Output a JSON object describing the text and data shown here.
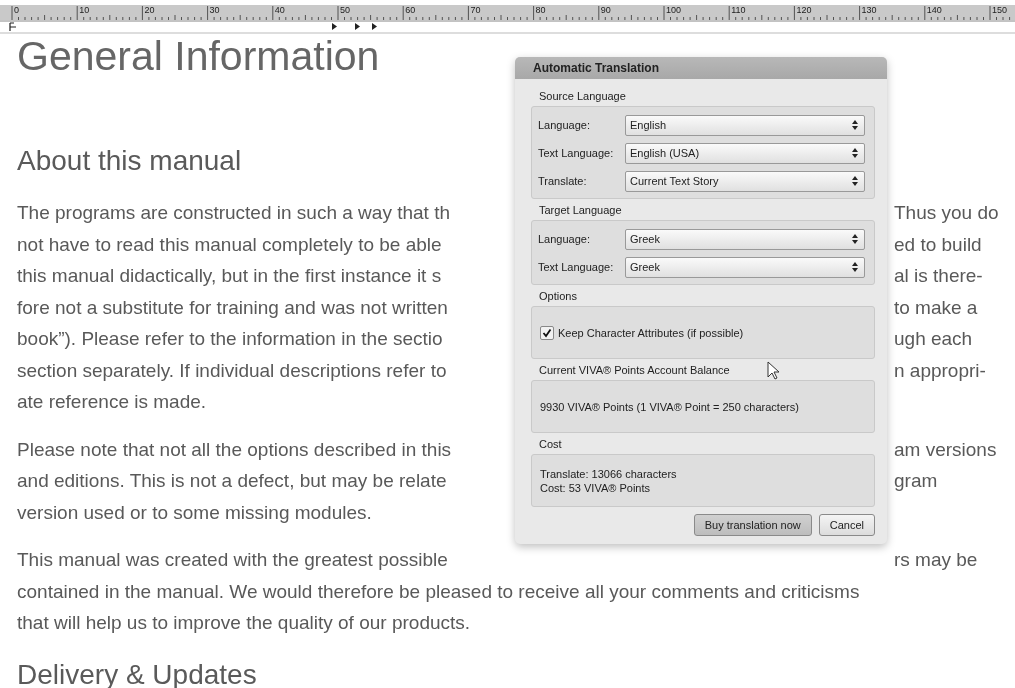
{
  "ruler": {
    "labels": [
      "0",
      "10",
      "20",
      "30",
      "40",
      "50",
      "60",
      "70",
      "80",
      "90",
      "100",
      "110",
      "120",
      "130",
      "140",
      "150"
    ]
  },
  "document": {
    "title": "General Information",
    "sections": [
      {
        "heading": "About this manual",
        "paragraphs": [
          {
            "lines": [
              {
                "left": "The programs are constructed in such a way that th",
                "right": "Thus you do"
              },
              {
                "left": "not have to read this manual completely to be able",
                "right": "ed to build"
              },
              {
                "left": "this manual didactically, but in the first instance it s",
                "right": "al is there-"
              },
              {
                "left": "fore not a substitute for training and was not written",
                "right": "to make a"
              },
              {
                "left": "book”). Please refer to the information in the sectio",
                "right": "ugh each"
              },
              {
                "left": "section separately. If individual descriptions refer to",
                "right": "n appropri-"
              },
              {
                "left": "ate reference is made."
              }
            ]
          },
          {
            "lines": [
              {
                "left": "Please note that not all the options described in this",
                "right": "am versions"
              },
              {
                "left": "and editions. This is not a defect, but may be relate",
                "right": "gram"
              },
              {
                "left": "version used or to some missing modules."
              }
            ]
          },
          {
            "lines": [
              {
                "left": "This manual was created with the greatest possible",
                "right": "rs may be"
              },
              {
                "left": "contained in the manual. We would therefore be pleased to receive all your comments and criticisms"
              },
              {
                "left": "that will help us to improve the quality of our products."
              }
            ]
          }
        ]
      },
      {
        "heading": "Delivery & Updates"
      }
    ]
  },
  "dialog": {
    "title": "Automatic Translation",
    "groups": [
      {
        "title": "Source Language",
        "kind": "selects",
        "rows": [
          {
            "label": "Language:",
            "value": "English"
          },
          {
            "label": "Text Language:",
            "value": "English (USA)"
          },
          {
            "label": "Translate:",
            "value": "Current Text Story"
          }
        ]
      },
      {
        "title": "Target Language",
        "kind": "selects",
        "rows": [
          {
            "label": "Language:",
            "value": "Greek"
          },
          {
            "label": "Text Language:",
            "value": "Greek"
          }
        ]
      },
      {
        "title": "Options",
        "kind": "checkbox",
        "items": [
          {
            "label": "Keep Character Attributes (if possible)",
            "checked": true
          }
        ]
      },
      {
        "title": "Current VIVA® Points Account Balance",
        "kind": "text",
        "lines": [
          "9930 VIVA® Points (1 VIVA® Point = 250 characters)"
        ]
      },
      {
        "title": "Cost",
        "kind": "text",
        "lines": [
          "Translate: 13066 characters",
          "Cost: 53 VIVA® Points"
        ]
      }
    ],
    "buttons": [
      {
        "label": "Buy translation now",
        "default": true
      },
      {
        "label": "Cancel",
        "default": false
      }
    ]
  }
}
